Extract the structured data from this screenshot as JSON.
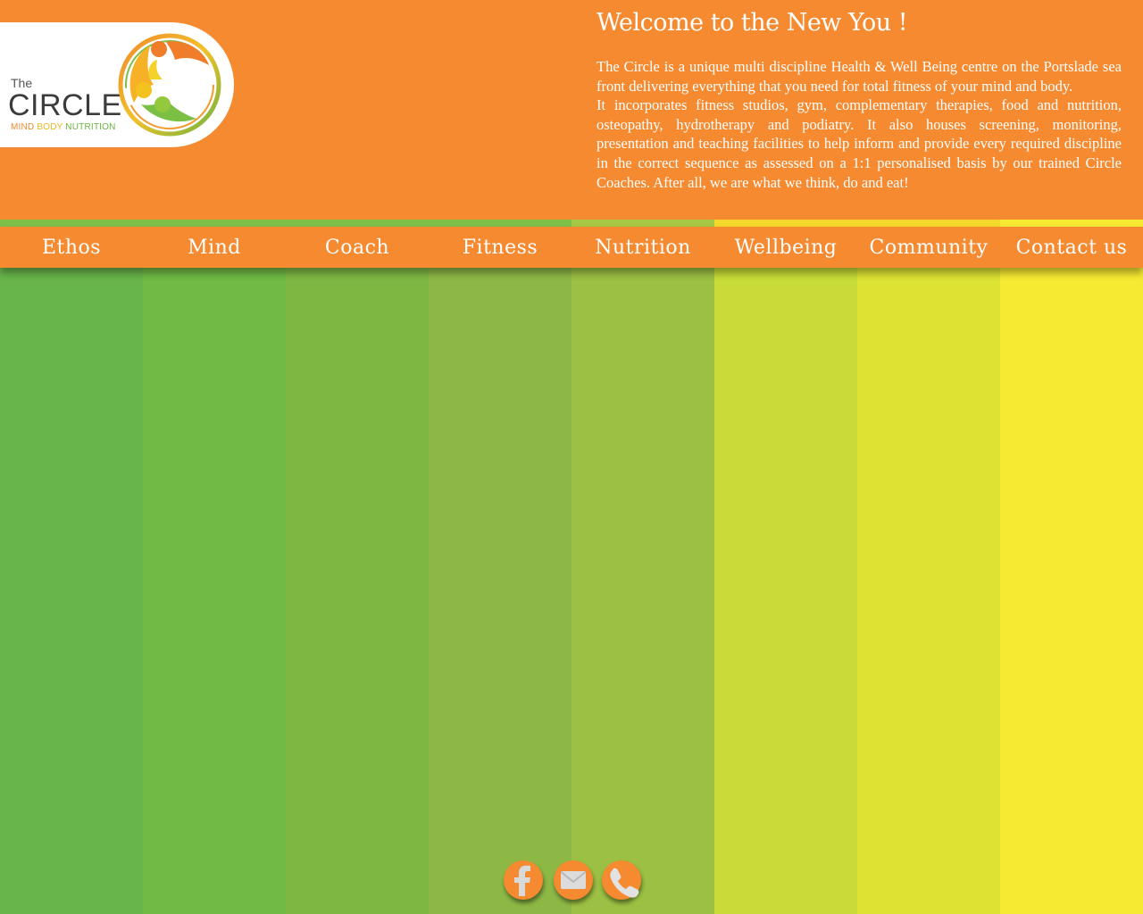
{
  "colors": {
    "header": "#f58a30",
    "stripes": [
      "#68b54a",
      "#70ba45",
      "#7eb843",
      "#8db845",
      "#9bc043",
      "#c8db38",
      "#dde233",
      "#f7ea33"
    ],
    "accent_bar": [
      "#7cc04a",
      "#7cc04a",
      "#7cc04a",
      "#7cc04a",
      "#a5c944",
      "#f4d82b",
      "#f4d82b",
      "#f7ea33"
    ]
  },
  "logo": {
    "the": "The",
    "name": "CIRCLE",
    "tagline_1": "MIND",
    "tagline_2": "BODY",
    "tagline_3": "NUTRITION"
  },
  "welcome": {
    "title": "Welcome to the New You !",
    "paragraph_1": "The Circle is a unique multi discipline Health & Well Being centre on the Portslade sea front delivering everything that you need for total fitness of your mind and body.",
    "paragraph_2": "It incorporates fitness studios, gym, complementary therapies, food and nutrition, osteopathy, hydrotherapy and podiatry. It also houses screening, monitoring, presentation and teaching facilities to help inform and provide every required discipline in the correct sequence as assessed on a 1:1 personalised basis by our trained Circle Coaches. After all, we are what we think, do and eat!"
  },
  "nav": {
    "items": [
      "Ethos",
      "Mind",
      "Coach",
      "Fitness",
      "Nutrition",
      "Wellbeing",
      "Community",
      "Contact us"
    ]
  },
  "social": {
    "icons": [
      "facebook-icon",
      "email-icon",
      "phone-icon"
    ]
  }
}
